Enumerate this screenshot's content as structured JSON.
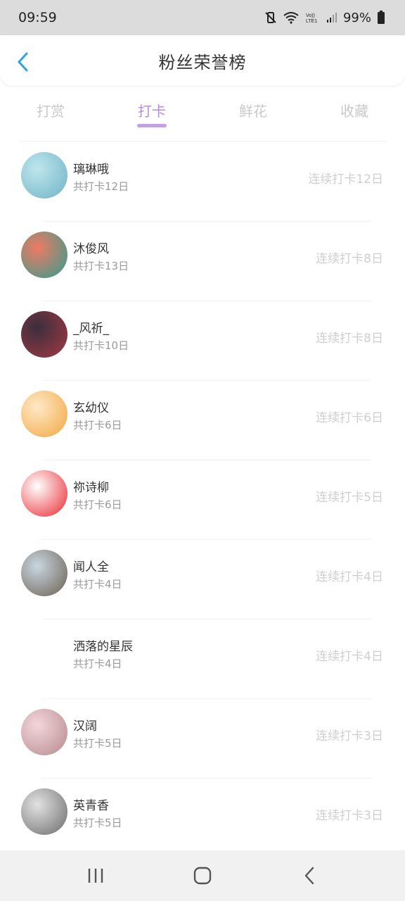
{
  "status_bar": {
    "time": "09:59",
    "battery": "99%",
    "icons": [
      "mute-vibrate-icon",
      "wifi-icon",
      "volte-icon",
      "signal-icon",
      "battery-icon"
    ]
  },
  "header": {
    "title": "粉丝荣誉榜",
    "back_icon": "chevron-left-icon"
  },
  "tabs": [
    {
      "label": "打赏",
      "active": false
    },
    {
      "label": "打卡",
      "active": true
    },
    {
      "label": "鲜花",
      "active": false
    },
    {
      "label": "收藏",
      "active": false
    }
  ],
  "list": [
    {
      "name": "璃琳哦",
      "total": "共打卡12日",
      "streak": "连续打卡12日",
      "avatar_colors": [
        "#bfe6ee",
        "#6fb3c4"
      ]
    },
    {
      "name": "沐俊风",
      "total": "共打卡13日",
      "streak": "连续打卡8日",
      "avatar_colors": [
        "#f07a63",
        "#2f9e8e"
      ]
    },
    {
      "name": "_风祈_",
      "total": "共打卡10日",
      "streak": "连续打卡8日",
      "avatar_colors": [
        "#3b2e3c",
        "#a33a45"
      ]
    },
    {
      "name": "玄幼仪",
      "total": "共打卡6日",
      "streak": "连续打卡6日",
      "avatar_colors": [
        "#ffe9c8",
        "#f2a640"
      ]
    },
    {
      "name": "祢诗柳",
      "total": "共打卡6日",
      "streak": "连续打卡5日",
      "avatar_colors": [
        "#ffffff",
        "#e8262e"
      ]
    },
    {
      "name": "闻人全",
      "total": "共打卡4日",
      "streak": "连续打卡4日",
      "avatar_colors": [
        "#c9d6e0",
        "#6a6052"
      ]
    },
    {
      "name": "洒落的星辰",
      "total": "共打卡4日",
      "streak": "连续打卡4日",
      "avatar_colors": [
        "#ffffff",
        "#ffffff"
      ]
    },
    {
      "name": "汉阔",
      "total": "共打卡5日",
      "streak": "连续打卡3日",
      "avatar_colors": [
        "#f3d6da",
        "#b58a8c"
      ]
    },
    {
      "name": "英青香",
      "total": "共打卡5日",
      "streak": "连续打卡3日",
      "avatar_colors": [
        "#e2e2e2",
        "#6b6b6b"
      ]
    }
  ],
  "nav_bar": {
    "icons": [
      "recent-apps-icon",
      "home-icon",
      "back-icon"
    ]
  },
  "colors": {
    "accent": "#b98be0",
    "back_icon": "#2aa4e6"
  }
}
